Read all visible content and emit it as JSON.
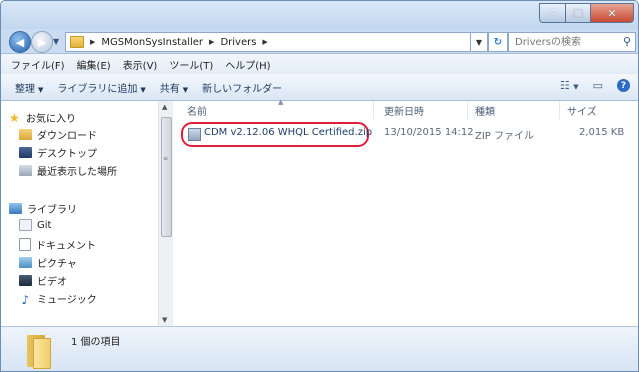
{
  "window": {
    "caption_buttons": [
      "minimize",
      "maximize",
      "close"
    ]
  },
  "address": {
    "crumbs": [
      "MGSMonSysInstaller",
      "Drivers"
    ],
    "search_placeholder": "Driversの検索"
  },
  "menu": [
    "ファイル(F)",
    "編集(E)",
    "表示(V)",
    "ツール(T)",
    "ヘルプ(H)"
  ],
  "toolbar": {
    "organize": "整理",
    "add_to_library": "ライブラリに追加",
    "share": "共有",
    "new_folder": "新しいフォルダー"
  },
  "nav": {
    "favorites": {
      "label": "お気に入り",
      "items": [
        "ダウンロード",
        "デスクトップ",
        "最近表示した場所"
      ]
    },
    "libraries": {
      "label": "ライブラリ",
      "items": [
        "Git",
        "ドキュメント",
        "ピクチャ",
        "ビデオ",
        "ミュージック"
      ]
    }
  },
  "columns": {
    "name": "名前",
    "date": "更新日時",
    "type": "種類",
    "size": "サイズ"
  },
  "files": [
    {
      "name": "CDM v2.12.06 WHQL Certified.zip",
      "date": "13/10/2015 14:12",
      "type": "ZIP ファイル",
      "size": "2,015 KB"
    }
  ],
  "details": {
    "count": "1 個の項目"
  },
  "colors": {
    "highlight": "#e0203a",
    "accent": "#2d6bc4"
  }
}
